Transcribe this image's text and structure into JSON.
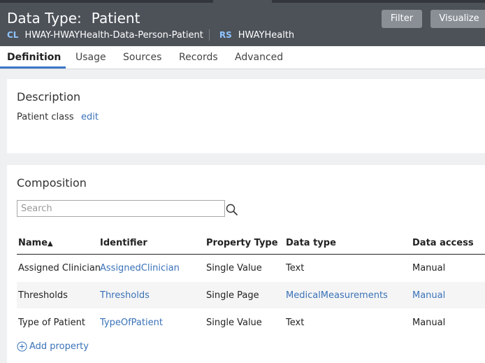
{
  "header": {
    "title_prefix": "Data Type:",
    "title_name": "Patient",
    "class_tag": "CL",
    "class_name": "HWAY-HWAYHealth-Data-Person-Patient",
    "ruleset_tag": "RS",
    "ruleset_name": "HWAYHealth",
    "filter_label": "Filter",
    "visualize_label": "Visualize"
  },
  "tabs": [
    {
      "label": "Definition",
      "active": true
    },
    {
      "label": "Usage"
    },
    {
      "label": "Sources"
    },
    {
      "label": "Records"
    },
    {
      "label": "Advanced"
    }
  ],
  "description": {
    "title": "Description",
    "text": "Patient class",
    "edit_label": "edit"
  },
  "composition": {
    "title": "Composition",
    "search_placeholder": "Search",
    "columns": {
      "name": "Name",
      "sort_indicator": "▲",
      "identifier": "Identifier",
      "property_type": "Property Type",
      "data_type": "Data type",
      "data_access": "Data access"
    },
    "rows": [
      {
        "name": "Assigned Clinician",
        "identifier": "AssignedClinician",
        "property_type": "Single Value",
        "data_type": "Text",
        "data_access": "Manual"
      },
      {
        "name": "Thresholds",
        "identifier": "Thresholds",
        "property_type": "Single Page",
        "data_type": "MedicalMeasurements",
        "data_access": "Manual"
      },
      {
        "name": "Type of Patient",
        "identifier": "TypeOfPatient",
        "property_type": "Single Value",
        "data_type": "Text",
        "data_access": "Manual"
      }
    ],
    "add_label": "Add property"
  }
}
